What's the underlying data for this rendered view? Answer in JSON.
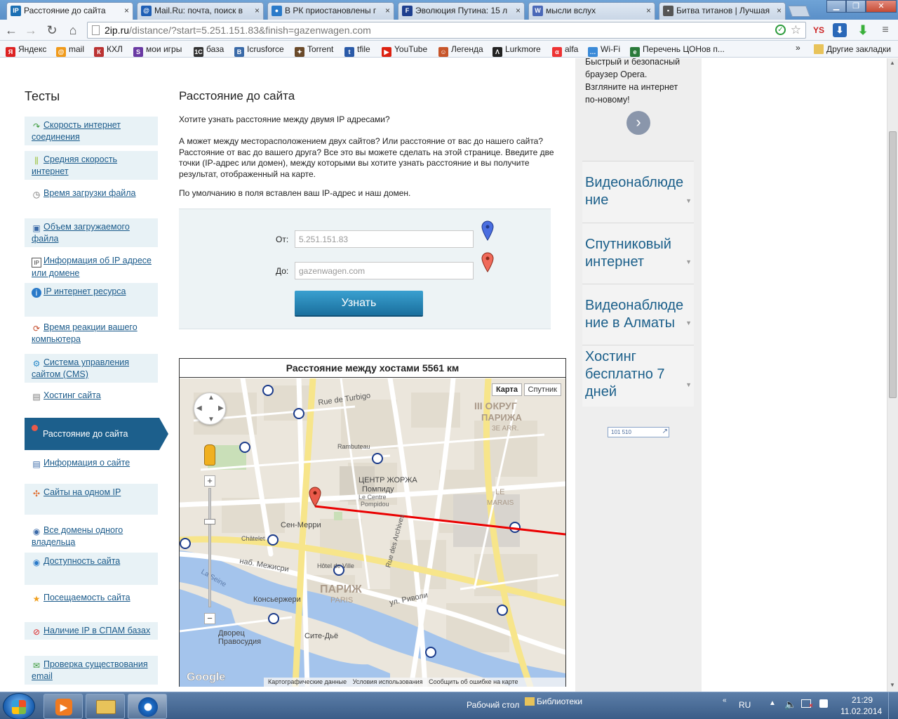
{
  "tabs": [
    {
      "label": "Расстояние до сайта",
      "icon": "IP",
      "color": "#1b6fb3",
      "active": true
    },
    {
      "label": "Mail.Ru: почта, поиск в",
      "icon": "@",
      "color": "#1f5fb5"
    },
    {
      "label": "В РК приостановлены г",
      "icon": "●",
      "color": "#2a7ac9"
    },
    {
      "label": "Эволюция Путина: 15 л",
      "icon": "F",
      "color": "#1e3f8f"
    },
    {
      "label": "мысли вслух",
      "icon": "W",
      "color": "#4a68b8"
    },
    {
      "label": "Битва титанов | Лучшая",
      "icon": "▪",
      "color": "#555"
    }
  ],
  "toolbar": {
    "url_host": "2ip.ru",
    "url_path": "/distance/?start=5.251.151.83&finish=gazenwagen.com"
  },
  "bookmarks": [
    {
      "label": "Яндекс",
      "icon": "Я",
      "color": "#d22"
    },
    {
      "label": "mail",
      "icon": "@",
      "color": "#f09a1a"
    },
    {
      "label": "КХЛ",
      "icon": "К",
      "color": "#b33"
    },
    {
      "label": "мои игры",
      "icon": "S",
      "color": "#6a3aa3"
    },
    {
      "label": "база",
      "icon": "1С",
      "color": "#333"
    },
    {
      "label": "Icrusforce",
      "icon": "B",
      "color": "#3a6aa8"
    },
    {
      "label": "Torrent",
      "icon": "✦",
      "color": "#6a4a2a"
    },
    {
      "label": "tfile",
      "icon": "t",
      "color": "#2a5aa8"
    },
    {
      "label": "YouTube",
      "icon": "▶",
      "color": "#d21"
    },
    {
      "label": "Легенда",
      "icon": "☺",
      "color": "#c7552a"
    },
    {
      "label": "Lurkmore",
      "icon": "Λ",
      "color": "#222"
    },
    {
      "label": "alfa",
      "icon": "α",
      "color": "#e33"
    },
    {
      "label": "Wi-Fi",
      "icon": "…",
      "color": "#3a8ad8"
    },
    {
      "label": "Перечень ЦОНов п...",
      "icon": "e",
      "color": "#2a7a3a"
    }
  ],
  "bookmarks_other": "Другие закладки",
  "sidebar": {
    "title": "Тесты",
    "items": [
      {
        "label": "Скорость интернет соединения",
        "icon": "↷"
      },
      {
        "label": "Средняя скорость интернет",
        "icon": "⫼"
      },
      {
        "label": "Время загрузки файла",
        "icon": "◷"
      },
      {
        "label": "Объем загружаемого файла",
        "icon": "▣"
      },
      {
        "label": "Информация об IP адресе или домене",
        "icon": "IP"
      },
      {
        "label": "IP интернет ресурса",
        "icon": "ℹ"
      },
      {
        "label": "Время реакции вашего компьютера",
        "icon": "⟳"
      },
      {
        "label": "Система управления сайтом (CMS)",
        "icon": "⚙"
      },
      {
        "label": "Хостинг сайта",
        "icon": "▤"
      },
      {
        "label": "Расстояние до сайта",
        "icon": "pin",
        "active": true
      },
      {
        "label": "Информация о сайте",
        "icon": "▤"
      },
      {
        "label": "Сайты на одном IP",
        "icon": "✣"
      },
      {
        "label": "Все домены одного владельца",
        "icon": "◉"
      },
      {
        "label": "Доступность сайта",
        "icon": "◉"
      },
      {
        "label": "Посещаемость сайта",
        "icon": "★"
      },
      {
        "label": "Наличие IP в СПАМ базах",
        "icon": "⊘"
      },
      {
        "label": "Проверка существования email",
        "icon": "✉"
      }
    ]
  },
  "main": {
    "title": "Расстояние до сайта",
    "intro1": "Хотите узнать расстояние между двумя IP адресами?",
    "intro2": "А может между месторасположением двух сайтов? Или расстояние от вас до нашего сайта? Расстояние от вас до вашего друга? Все это вы можете сделать на этой странице. Введите две точки (IP-адрес или домен), между которыми вы хотите узнать расстояние и вы получите результат, отображенный на карте.",
    "intro3": "По умолчанию в поля вставлен ваш IP-адрес и наш домен.",
    "from_label": "От:",
    "from_value": "5.251.151.83",
    "to_label": "До:",
    "to_value": "gazenwagen.com",
    "submit_label": "Узнать",
    "map_title": "Расстояние между хостами 5561 км",
    "map_type_map": "Карта",
    "map_type_sat": "Спутник",
    "map_footer_data": "Картографические данные",
    "map_footer_terms": "Условия использования",
    "map_footer_report": "Сообщить об ошибке на карте",
    "map_logo": "Google",
    "map_labels": [
      "III ОКРУГ",
      "ПАРИЖА",
      "3E ARR.",
      "ЦЕНТР ЖОРЖА",
      "Помпиду",
      "Le Centre",
      "Pompidou",
      "ПАРИЖ",
      "PARIS",
      "Сен-Мерри",
      "Консьержери",
      "Дворец",
      "Правосудия",
      "Сите-Дьё",
      "Rue de Turbigo",
      "Rambuteau",
      "Châtelet",
      "LE",
      "MARAIS",
      "Hôtel de Ville",
      "Rue des Archives",
      "ул. Риволи",
      "наб. Межисри",
      "La Seine"
    ]
  },
  "right": {
    "opera_text": "Быстрый и безопасный браузер Opera. Взгляните на интернет по-новому!",
    "ads": [
      "Видеонаблюде ние",
      "Спутниковый интернет",
      "Видеонаблюде ние в Алматы",
      "Хостинг бесплатно 7 дней"
    ],
    "counter": "101 510"
  },
  "taskbar": {
    "desktop_label": "Рабочий стол",
    "libraries_label": "Библиотеки",
    "lang": "RU",
    "time": "21:29",
    "date": "11.02.2014"
  }
}
